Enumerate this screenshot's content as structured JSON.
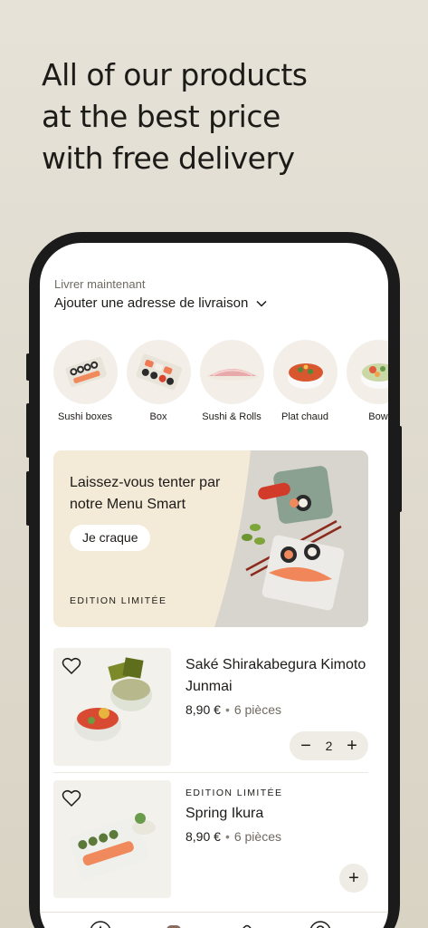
{
  "headline": {
    "line1": "All of our products",
    "line2": "at the best price",
    "line3": "with free delivery"
  },
  "address": {
    "label": "Livrer maintenant",
    "value": "Ajouter une adresse de livraison",
    "icon": "chevron-down-icon"
  },
  "categories": [
    {
      "label": "Sushi boxes"
    },
    {
      "label": "Box"
    },
    {
      "label": "Sushi & Rolls"
    },
    {
      "label": "Plat chaud"
    },
    {
      "label": "Bow"
    }
  ],
  "banner": {
    "title": "Laissez-vous tenter par notre Menu Smart",
    "button": "Je craque",
    "tag": "EDITION LIMITÉE"
  },
  "products": [
    {
      "tag": "",
      "name": "Saké Shirakabegura Kimoto Junmai",
      "price": "8,90 €",
      "separator": "•",
      "pieces": "6 pièces",
      "quantity": "2",
      "minus": "−",
      "plus": "+"
    },
    {
      "tag": "EDITION LIMITÉE",
      "name": "Spring Ikura",
      "price": "8,90 €",
      "separator": "•",
      "pieces": "6 pièces",
      "plus": "+"
    }
  ],
  "tabbar": {
    "tabs": [
      "home-icon",
      "bag-icon",
      "basket-icon",
      "profile-icon"
    ]
  },
  "colors": {
    "background": "#e2ddd2",
    "banner": "#f3ead7",
    "text": "#1d1b18",
    "accent": "#ff5a36"
  }
}
